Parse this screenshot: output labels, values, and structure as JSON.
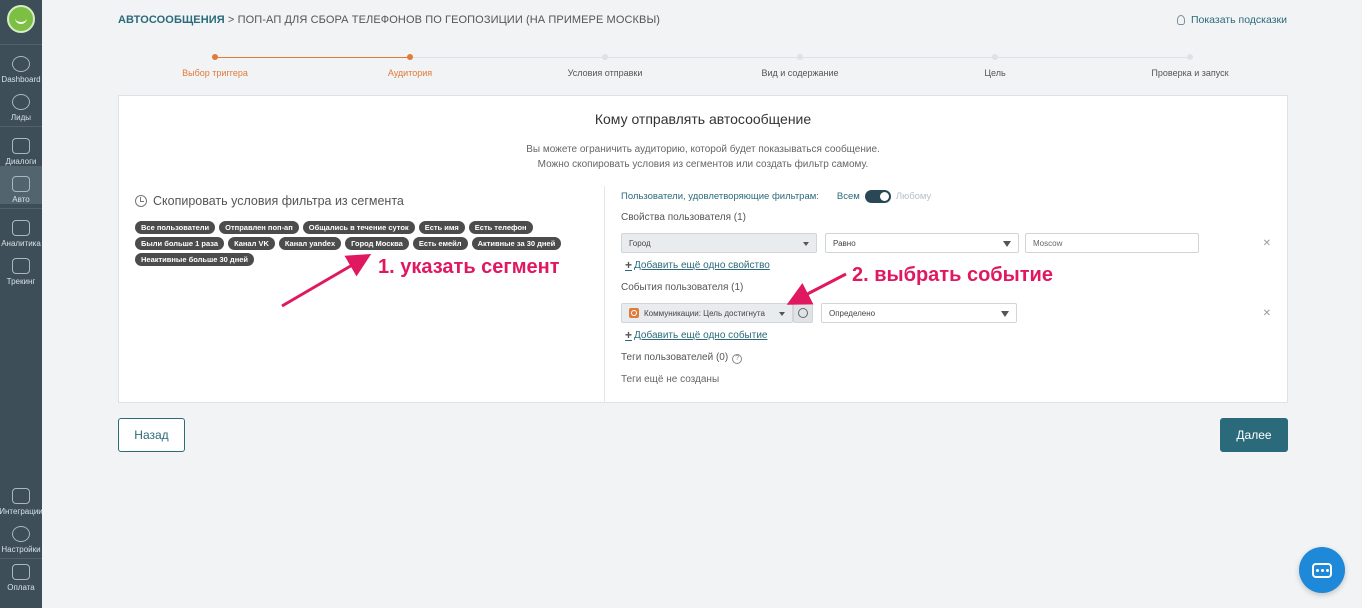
{
  "sidebar": {
    "items": [
      {
        "label": "Dashboard",
        "icon": "gauge-icon"
      },
      {
        "label": "Лиды",
        "icon": "users-icon"
      },
      {
        "label": "Диалоги",
        "icon": "chat-icon"
      },
      {
        "label": "Авто",
        "icon": "monitor-icon"
      },
      {
        "label": "Аналитика",
        "icon": "funnel-icon"
      },
      {
        "label": "Трекинг",
        "icon": "cursor-icon"
      },
      {
        "label": "Интеграции",
        "icon": "puzzle-icon"
      },
      {
        "label": "Настройки",
        "icon": "gear-icon"
      },
      {
        "label": "Оплата",
        "icon": "card-icon"
      }
    ]
  },
  "header": {
    "breadcrumb_link": "АВТОСООБЩЕНИЯ",
    "breadcrumb_rest": " > ПОП-АП ДЛЯ СБОРА ТЕЛЕФОНОВ ПО ГЕОПОЗИЦИИ (НА ПРИМЕРЕ МОСКВЫ)",
    "hints": "Показать подсказки"
  },
  "steps": [
    {
      "label": "Выбор триггера",
      "state": "done"
    },
    {
      "label": "Аудитория",
      "state": "current"
    },
    {
      "label": "Условия отправки",
      "state": "todo"
    },
    {
      "label": "Вид и содержание",
      "state": "todo"
    },
    {
      "label": "Цель",
      "state": "todo"
    },
    {
      "label": "Проверка и запуск",
      "state": "todo"
    }
  ],
  "card": {
    "title": "Кому отправлять автосообщение",
    "desc_line1": "Вы можете ограничить аудиторию, которой будет показываться сообщение.",
    "desc_line2": "Можно скопировать условия из сегментов или создать фильтр самому.",
    "copy_title": "Скопировать условия фильтра из сегмента",
    "segments": [
      "Все пользователи",
      "Отправлен поп-ап",
      "Общались в течение суток",
      "Есть имя",
      "Есть телефон",
      "Были больше 1 раза",
      "Канал VK",
      "Канал yandex",
      "Город Москва",
      "Есть емейл",
      "Активные за 30 дней",
      "Неактивные больше 30 дней"
    ]
  },
  "filters": {
    "match_label": "Пользователи, удовлетворяющие фильтрам:",
    "all": "Всем",
    "any": "Любому",
    "props_title": "Свойства пользователя (1)",
    "prop_field": "Город",
    "prop_op": "Равно",
    "prop_value": "Moscow",
    "add_prop": "Добавить ещё одно свойство",
    "events_title": "События пользователя (1)",
    "event_field": "Коммуникации: Цель достигнута",
    "event_op": "Определено",
    "add_event": "Добавить ещё одно событие",
    "tags_title": "Теги пользователей (0)",
    "tags_empty": "Теги ещё не созданы"
  },
  "annotations": {
    "one": "1. указать сегмент",
    "two": "2. выбрать событие"
  },
  "buttons": {
    "back": "Назад",
    "next": "Далее"
  },
  "colors": {
    "accent": "#2b6a7a",
    "step_done": "#e07b3a",
    "annotation": "#e0185f",
    "sidebar": "#3d4e59"
  }
}
